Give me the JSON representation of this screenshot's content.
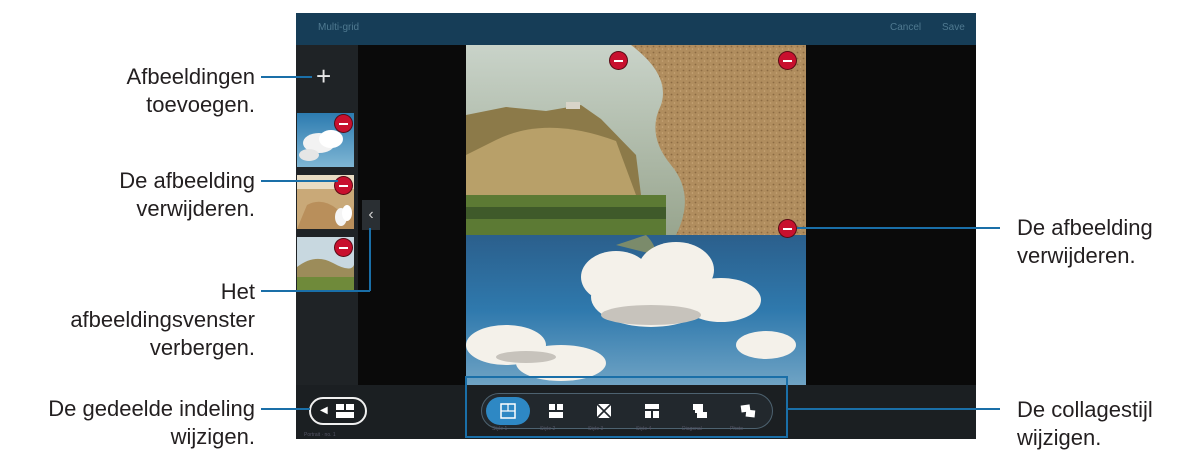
{
  "callouts": {
    "add_images": [
      "Afbeeldingen",
      "toevoegen."
    ],
    "delete_image_left": [
      "De afbeelding",
      "verwijderen."
    ],
    "hide_panel": [
      "Het",
      "afbeeldingsvenster",
      "verbergen."
    ],
    "change_split_layout": [
      "De gedeelde indeling",
      "wijzigen."
    ],
    "delete_image_right": [
      "De afbeelding",
      "verwijderen."
    ],
    "change_collage_style": [
      "De collagestijl",
      "wijzigen."
    ]
  },
  "screen": {
    "appbar": {
      "title": "Multi-grid",
      "cancel": "Cancel",
      "save": "Save"
    },
    "bottom": {
      "mode_text": "Portrait · no. 1",
      "style_labels": [
        "Style 1",
        "Style 2",
        "Style 3",
        "Style 4",
        "Diagonal",
        "Photo"
      ]
    }
  },
  "colors": {
    "accent_line": "#1a6fa8",
    "delete_badge": "#c8102e",
    "selected_style": "#2e88c4",
    "appbar": "#163d57"
  },
  "icons": [
    "plus-icon",
    "minus-icon",
    "chevron-left-icon",
    "grid-layout-icon",
    "collage-style-icon"
  ]
}
